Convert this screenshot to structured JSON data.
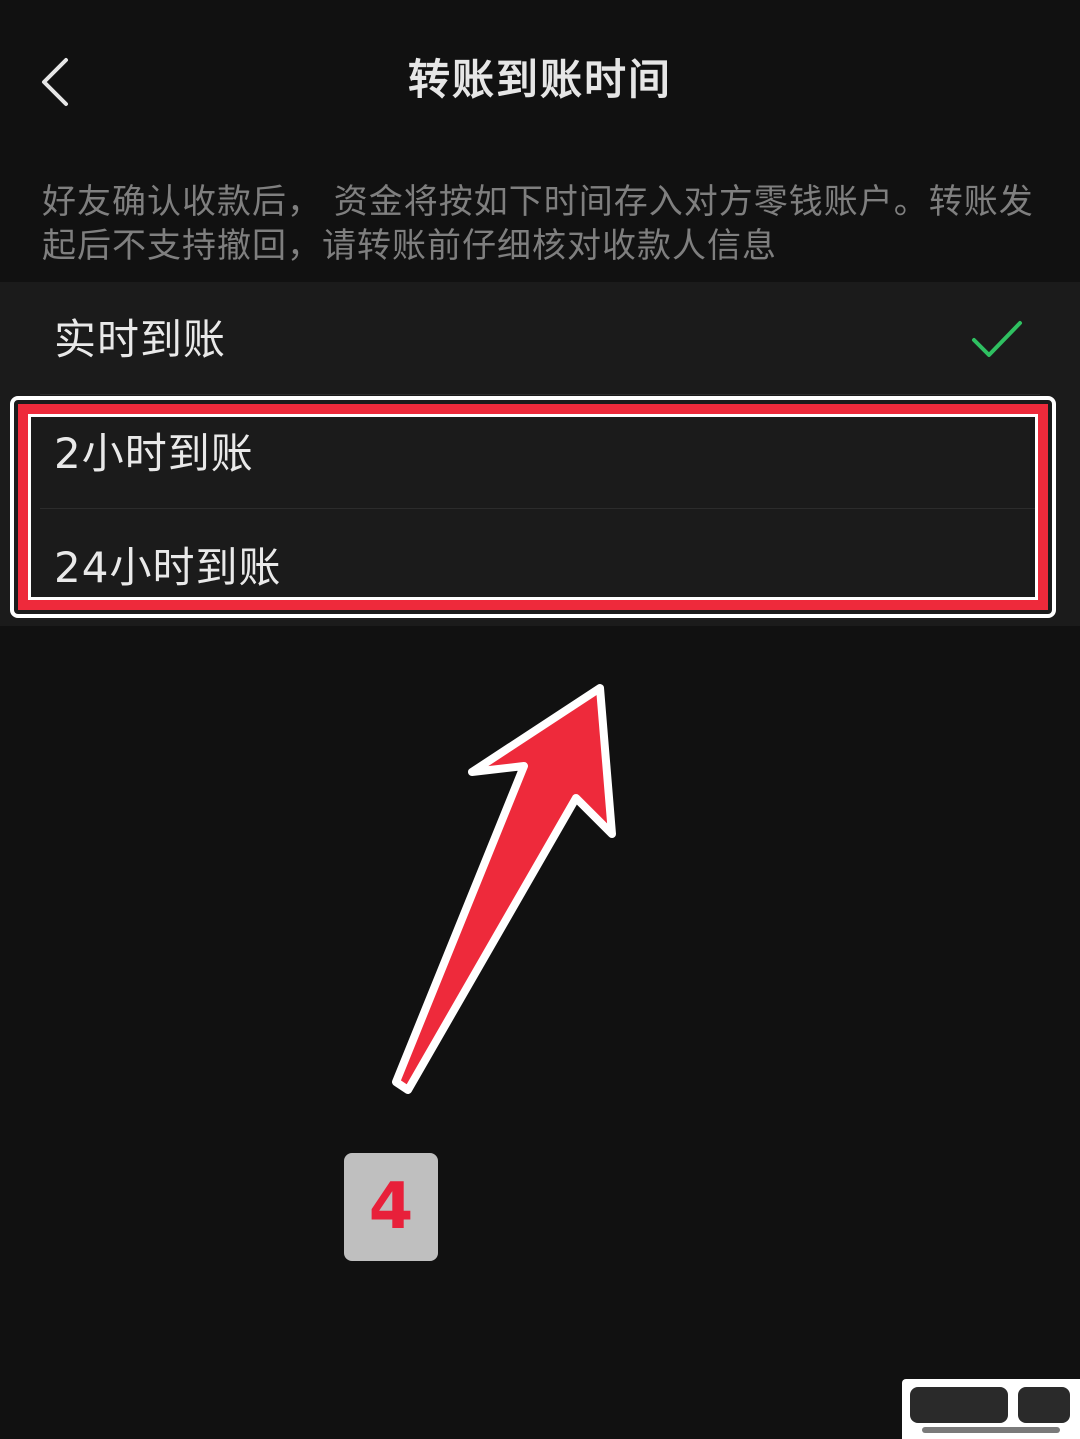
{
  "header": {
    "title": "转账到账时间",
    "back_icon": "chevron-left-icon"
  },
  "notice": {
    "text": "好友确认收款后， 资金将按如下时间存入对方零钱账户。转账发起后不支持撤回，请转账前仔细核对收款人信息"
  },
  "options": [
    {
      "label": "实时到账",
      "selected": true
    },
    {
      "label": "2小时到账",
      "selected": false
    },
    {
      "label": "24小时到账",
      "selected": false
    }
  ],
  "annotation": {
    "step_number": "4",
    "highlight_color": "#ee2a3b",
    "arrow_color": "#ee2a3b"
  },
  "colors": {
    "background": "#111111",
    "option_background": "#1b1b1b",
    "check_color": "#2fc061",
    "text_primary": "#e9e9e9",
    "text_secondary": "#7f7f7f"
  }
}
